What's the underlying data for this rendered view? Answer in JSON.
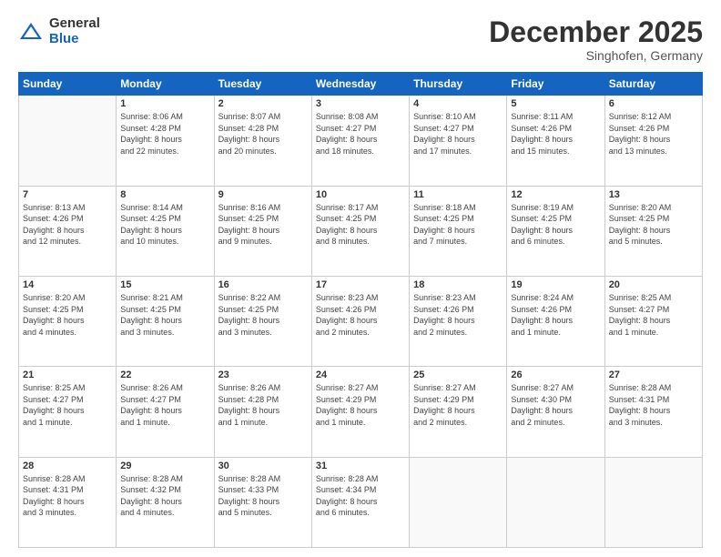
{
  "logo": {
    "general": "General",
    "blue": "Blue"
  },
  "header": {
    "month": "December 2025",
    "location": "Singhofen, Germany"
  },
  "weekdays": [
    "Sunday",
    "Monday",
    "Tuesday",
    "Wednesday",
    "Thursday",
    "Friday",
    "Saturday"
  ],
  "days": [
    {
      "num": "",
      "info": ""
    },
    {
      "num": "1",
      "info": "Sunrise: 8:06 AM\nSunset: 4:28 PM\nDaylight: 8 hours\nand 22 minutes."
    },
    {
      "num": "2",
      "info": "Sunrise: 8:07 AM\nSunset: 4:28 PM\nDaylight: 8 hours\nand 20 minutes."
    },
    {
      "num": "3",
      "info": "Sunrise: 8:08 AM\nSunset: 4:27 PM\nDaylight: 8 hours\nand 18 minutes."
    },
    {
      "num": "4",
      "info": "Sunrise: 8:10 AM\nSunset: 4:27 PM\nDaylight: 8 hours\nand 17 minutes."
    },
    {
      "num": "5",
      "info": "Sunrise: 8:11 AM\nSunset: 4:26 PM\nDaylight: 8 hours\nand 15 minutes."
    },
    {
      "num": "6",
      "info": "Sunrise: 8:12 AM\nSunset: 4:26 PM\nDaylight: 8 hours\nand 13 minutes."
    },
    {
      "num": "7",
      "info": "Sunrise: 8:13 AM\nSunset: 4:26 PM\nDaylight: 8 hours\nand 12 minutes."
    },
    {
      "num": "8",
      "info": "Sunrise: 8:14 AM\nSunset: 4:25 PM\nDaylight: 8 hours\nand 10 minutes."
    },
    {
      "num": "9",
      "info": "Sunrise: 8:16 AM\nSunset: 4:25 PM\nDaylight: 8 hours\nand 9 minutes."
    },
    {
      "num": "10",
      "info": "Sunrise: 8:17 AM\nSunset: 4:25 PM\nDaylight: 8 hours\nand 8 minutes."
    },
    {
      "num": "11",
      "info": "Sunrise: 8:18 AM\nSunset: 4:25 PM\nDaylight: 8 hours\nand 7 minutes."
    },
    {
      "num": "12",
      "info": "Sunrise: 8:19 AM\nSunset: 4:25 PM\nDaylight: 8 hours\nand 6 minutes."
    },
    {
      "num": "13",
      "info": "Sunrise: 8:20 AM\nSunset: 4:25 PM\nDaylight: 8 hours\nand 5 minutes."
    },
    {
      "num": "14",
      "info": "Sunrise: 8:20 AM\nSunset: 4:25 PM\nDaylight: 8 hours\nand 4 minutes."
    },
    {
      "num": "15",
      "info": "Sunrise: 8:21 AM\nSunset: 4:25 PM\nDaylight: 8 hours\nand 3 minutes."
    },
    {
      "num": "16",
      "info": "Sunrise: 8:22 AM\nSunset: 4:25 PM\nDaylight: 8 hours\nand 3 minutes."
    },
    {
      "num": "17",
      "info": "Sunrise: 8:23 AM\nSunset: 4:26 PM\nDaylight: 8 hours\nand 2 minutes."
    },
    {
      "num": "18",
      "info": "Sunrise: 8:23 AM\nSunset: 4:26 PM\nDaylight: 8 hours\nand 2 minutes."
    },
    {
      "num": "19",
      "info": "Sunrise: 8:24 AM\nSunset: 4:26 PM\nDaylight: 8 hours\nand 1 minute."
    },
    {
      "num": "20",
      "info": "Sunrise: 8:25 AM\nSunset: 4:27 PM\nDaylight: 8 hours\nand 1 minute."
    },
    {
      "num": "21",
      "info": "Sunrise: 8:25 AM\nSunset: 4:27 PM\nDaylight: 8 hours\nand 1 minute."
    },
    {
      "num": "22",
      "info": "Sunrise: 8:26 AM\nSunset: 4:27 PM\nDaylight: 8 hours\nand 1 minute."
    },
    {
      "num": "23",
      "info": "Sunrise: 8:26 AM\nSunset: 4:28 PM\nDaylight: 8 hours\nand 1 minute."
    },
    {
      "num": "24",
      "info": "Sunrise: 8:27 AM\nSunset: 4:29 PM\nDaylight: 8 hours\nand 1 minute."
    },
    {
      "num": "25",
      "info": "Sunrise: 8:27 AM\nSunset: 4:29 PM\nDaylight: 8 hours\nand 2 minutes."
    },
    {
      "num": "26",
      "info": "Sunrise: 8:27 AM\nSunset: 4:30 PM\nDaylight: 8 hours\nand 2 minutes."
    },
    {
      "num": "27",
      "info": "Sunrise: 8:28 AM\nSunset: 4:31 PM\nDaylight: 8 hours\nand 3 minutes."
    },
    {
      "num": "28",
      "info": "Sunrise: 8:28 AM\nSunset: 4:31 PM\nDaylight: 8 hours\nand 3 minutes."
    },
    {
      "num": "29",
      "info": "Sunrise: 8:28 AM\nSunset: 4:32 PM\nDaylight: 8 hours\nand 4 minutes."
    },
    {
      "num": "30",
      "info": "Sunrise: 8:28 AM\nSunset: 4:33 PM\nDaylight: 8 hours\nand 5 minutes."
    },
    {
      "num": "31",
      "info": "Sunrise: 8:28 AM\nSunset: 4:34 PM\nDaylight: 8 hours\nand 6 minutes."
    },
    {
      "num": "",
      "info": ""
    },
    {
      "num": "",
      "info": ""
    },
    {
      "num": "",
      "info": ""
    },
    {
      "num": "",
      "info": ""
    }
  ]
}
